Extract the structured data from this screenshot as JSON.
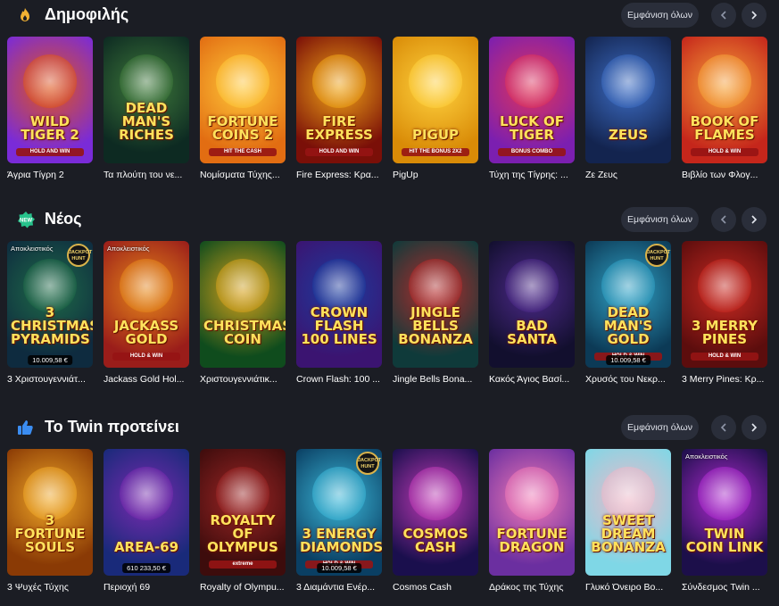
{
  "ui": {
    "show_all": "Εμφάνιση όλων"
  },
  "sections": [
    {
      "title": "Δημοφιλής",
      "icon": "flame-icon",
      "games": [
        {
          "name": "Άγρια Τίγρη 2",
          "logo": "WILD TIGER 2",
          "sub": "HOLD AND WIN",
          "colors": [
            "#7a2bd8",
            "#e0561a"
          ]
        },
        {
          "name": "Τα πλούτη του νε...",
          "logo": "DEAD MAN'S RICHES",
          "sub": "",
          "colors": [
            "#0d2a22",
            "#3f7a3b"
          ]
        },
        {
          "name": "Νομίσματα Τύχης...",
          "logo": "FORTUNE COINS 2",
          "sub": "HIT THE CASH",
          "colors": [
            "#e26d12",
            "#ffc93a"
          ]
        },
        {
          "name": "Fire Express: Κρα...",
          "logo": "FIRE EXPRESS",
          "sub": "HOLD AND WIN",
          "colors": [
            "#7a0f08",
            "#f0a517"
          ]
        },
        {
          "name": "PigUp",
          "logo": "PIGUP",
          "sub": "HIT THE BONUS 2X2",
          "colors": [
            "#d98b07",
            "#ffd23f"
          ]
        },
        {
          "name": "Τύχη της Τίγρης: ...",
          "logo": "LUCK OF TIGER",
          "sub": "BONUS COMBO",
          "colors": [
            "#7b1fb0",
            "#e0345a"
          ]
        },
        {
          "name": "Ζε Ζευς",
          "logo": "ZEUS",
          "sub": "",
          "colors": [
            "#13244f",
            "#3d6dc4"
          ]
        },
        {
          "name": "Βιβλίο των Φλογ...",
          "logo": "BOOK OF FLAMES",
          "sub": "HOLD & WIN",
          "colors": [
            "#c5261b",
            "#f7a43a"
          ]
        }
      ]
    },
    {
      "title": "Νέος",
      "icon": "new-badge-icon",
      "games": [
        {
          "name": "3 Χριστουγεννιάτ...",
          "logo": "3 CHRISTMAS PYRAMIDS",
          "sub": "",
          "colors": [
            "#0e2b3f",
            "#1f6b48"
          ],
          "exclusive": "Αποκλειστικός",
          "jackpot_badge": "JACKPOT HUNT",
          "amount": "10.009,58 €"
        },
        {
          "name": "Jackass Gold Hol...",
          "logo": "JACKASS GOLD",
          "sub": "HOLD & WIN",
          "colors": [
            "#9a1d1a",
            "#e7891b"
          ],
          "exclusive": "Αποκλειστικός"
        },
        {
          "name": "Χριστουγεννιάτικ...",
          "logo": "CHRISTMAS COIN",
          "sub": "",
          "colors": [
            "#0f4c1d",
            "#d7a21c"
          ]
        },
        {
          "name": "Crown Flash: 100 ...",
          "logo": "CROWN FLASH 100 LINES",
          "sub": "",
          "colors": [
            "#3b1471",
            "#1c3c9e"
          ]
        },
        {
          "name": "Jingle Bells Bona...",
          "logo": "JINGLE BELLS BONANZA",
          "sub": "",
          "colors": [
            "#0f3a3a",
            "#b52b2b"
          ]
        },
        {
          "name": "Κακός Άγιος Βασί...",
          "logo": "BAD SANTA",
          "sub": "",
          "colors": [
            "#120f2e",
            "#4d2a8a"
          ]
        },
        {
          "name": "Χρυσός του Νεκρ...",
          "logo": "DEAD MAN'S GOLD",
          "sub": "HOLD & WIN",
          "colors": [
            "#0c3a56",
            "#31a3c7"
          ],
          "jackpot_badge": "JACKPOT HUNT",
          "amount": "10.009,58 €"
        },
        {
          "name": "3 Merry Pines: Κρ...",
          "logo": "3 MERRY PINES",
          "sub": "HOLD & WIN",
          "colors": [
            "#5c0d0d",
            "#c92a22"
          ]
        }
      ]
    },
    {
      "title": "Το Twin προτείνει",
      "icon": "thumbs-up-icon",
      "games": [
        {
          "name": "3 Ψυχές Τύχης",
          "logo": "3 FORTUNE SOULS",
          "sub": "",
          "colors": [
            "#8a3a05",
            "#f1a928"
          ]
        },
        {
          "name": "Περιοχή 69",
          "logo": "AREA-69",
          "sub": "",
          "colors": [
            "#192a7a",
            "#7a2bb0"
          ],
          "amount": "610 233,50 €"
        },
        {
          "name": "Royalty of Olympu...",
          "logo": "ROYALTY OF OLYMPUS",
          "sub": "extreme",
          "colors": [
            "#3d0c0c",
            "#9e2626"
          ]
        },
        {
          "name": "3 Διαμάντια Ενέρ...",
          "logo": "3 ENERGY DIAMONDS",
          "sub": "HOLD & WIN",
          "colors": [
            "#0a3f63",
            "#3cb8d9"
          ],
          "jackpot_badge": "JACKPOT HUNT",
          "amount": "10.009,58 €"
        },
        {
          "name": "Cosmos Cash",
          "logo": "COSMOS CASH",
          "sub": "",
          "colors": [
            "#1a0f4d",
            "#c23bb8"
          ]
        },
        {
          "name": "Δράκος της Τύχης",
          "logo": "FORTUNE DRAGON",
          "sub": "",
          "colors": [
            "#6b2fa0",
            "#f27ab6"
          ]
        },
        {
          "name": "Γλυκό Όνειρο Βο...",
          "logo": "SWEET DREAM BONANZA",
          "sub": "",
          "colors": [
            "#7fd7e6",
            "#f0b8c8"
          ]
        },
        {
          "name": "Σύνδεσμος Twin ...",
          "logo": "TWIN COIN LINK",
          "sub": "",
          "colors": [
            "#1c0f4a",
            "#b02bd1"
          ],
          "exclusive": "Αποκλειστικός"
        }
      ]
    }
  ]
}
